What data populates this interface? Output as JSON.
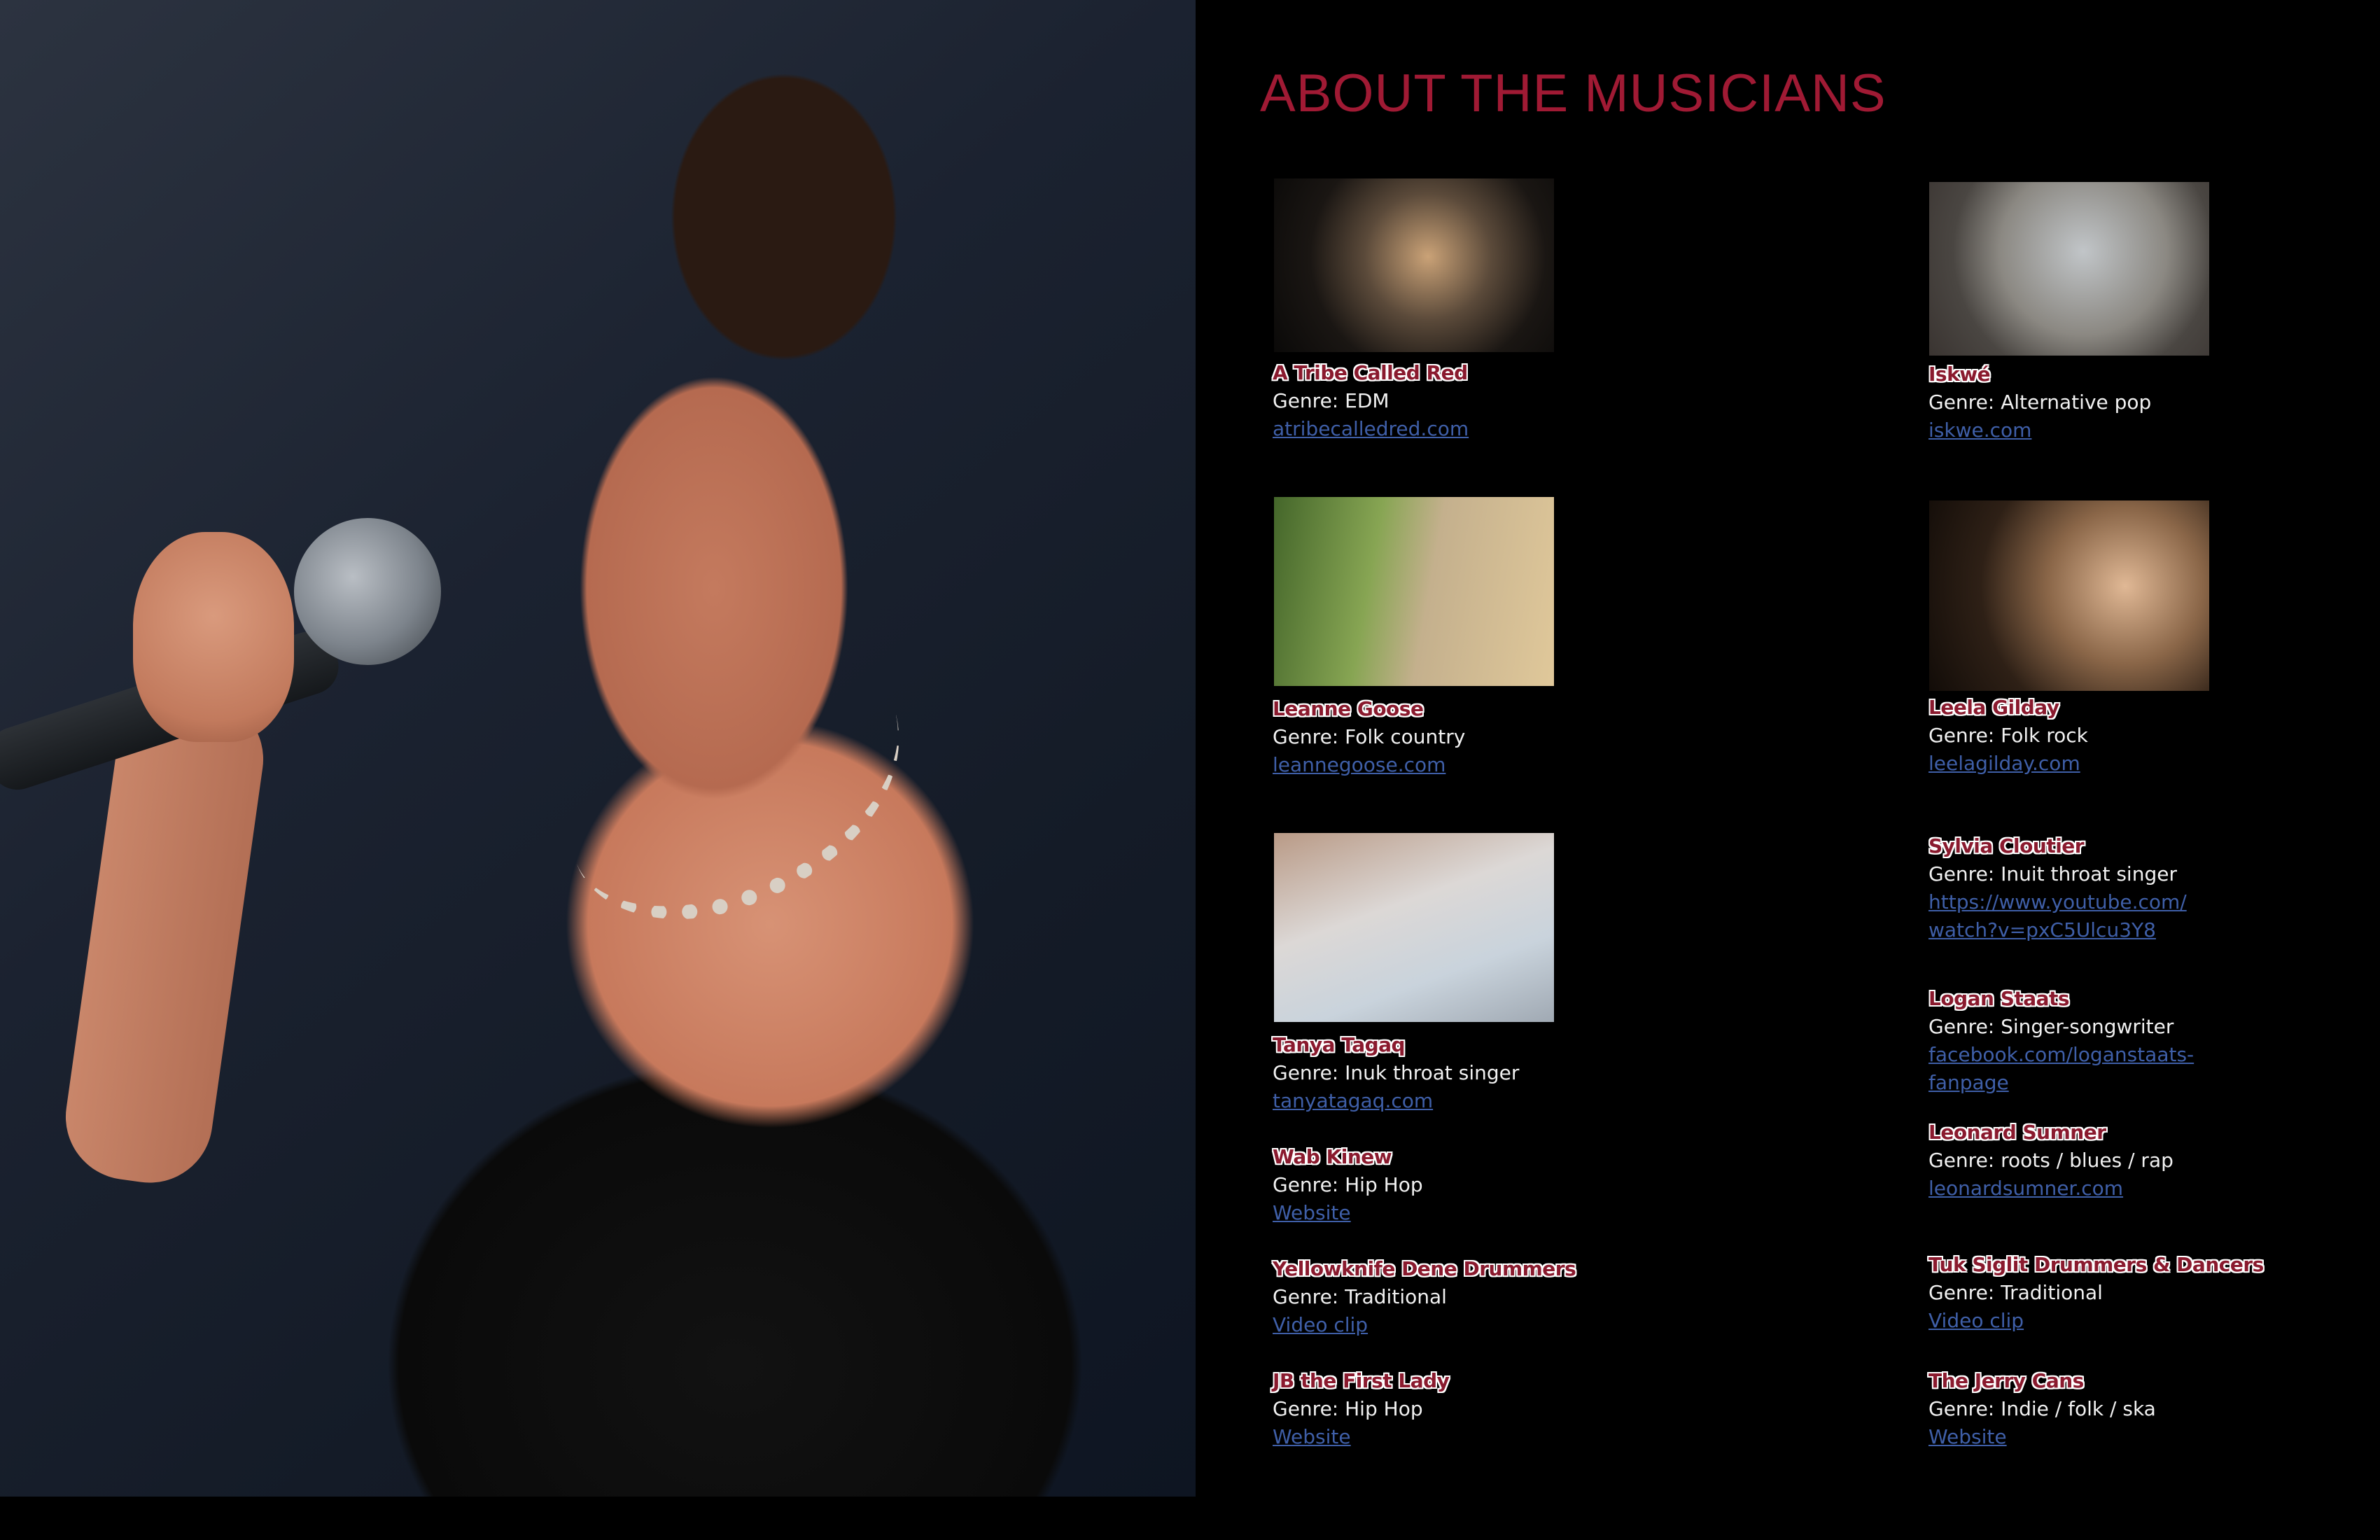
{
  "page": {
    "title": "ABOUT THE MUSICIANS"
  },
  "musicians": [
    {
      "name": "A Tribe Called Red",
      "genre": "Genre: EDM",
      "link": "atribecalledred.com"
    },
    {
      "name": "Iskwé",
      "genre": "Genre: Alternative pop",
      "link": "iskwe.com"
    },
    {
      "name": "Leanne Goose",
      "genre": "Genre: Folk country",
      "link": "leannegoose.com"
    },
    {
      "name": "Leela Gilday",
      "genre": "Genre: Folk rock",
      "link": "leelagilday.com"
    },
    {
      "name": "Sylvia Cloutier",
      "genre": "Genre: Inuit throat singer",
      "link_line1": "https://www.youtube.com/",
      "link_line2": "watch?v=pxC5Ulcu3Y8"
    },
    {
      "name": "Tanya Tagaq",
      "genre": "Genre: Inuk throat singer",
      "link": "tanyatagaq.com"
    },
    {
      "name": "Logan Staats",
      "genre": "Genre: Singer-songwriter",
      "link_line1": "facebook.com/loganstaats-",
      "link_line2": "fanpage"
    },
    {
      "name": "Leonard Sumner",
      "genre": "Genre: roots / blues / rap",
      "link": "leonardsumner.com"
    },
    {
      "name": "Wab Kinew",
      "genre": "Genre: Hip Hop",
      "link": "Website"
    },
    {
      "name": "Yellowknife Dene Drummers",
      "genre": "Genre: Traditional",
      "link": "Video clip"
    },
    {
      "name": "Tuk Siglit Drummers & Dancers",
      "genre": "Genre: Traditional",
      "link": " Video clip"
    },
    {
      "name": "JB the First Lady",
      "genre": "Genre: Hip Hop",
      "link": "Website"
    },
    {
      "name": "The Jerry Cans",
      "genre": "Genre: Indie / folk / ska",
      "link": " Website"
    }
  ]
}
